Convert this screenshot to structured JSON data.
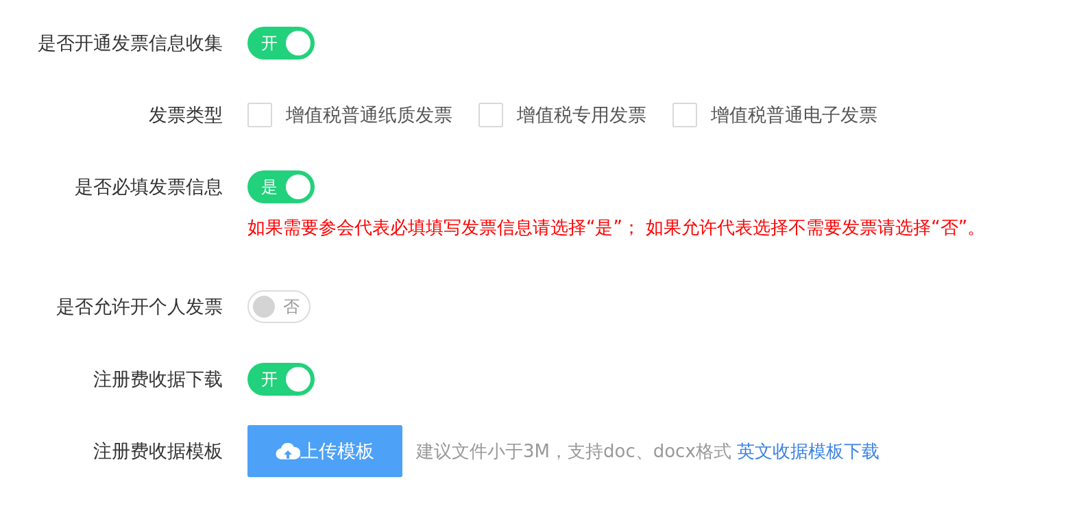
{
  "rows": [
    {
      "kind": "switch",
      "label": "是否开通发票信息收集",
      "on": true,
      "text": "开"
    },
    {
      "kind": "checkboxes",
      "label": "发票类型",
      "options": [
        {
          "label": "增值税普通纸质发票",
          "checked": false
        },
        {
          "label": "增值税专用发票",
          "checked": false
        },
        {
          "label": "增值税普通电子发票",
          "checked": false
        }
      ]
    },
    {
      "kind": "switch",
      "label": "是否必填发票信息",
      "on": true,
      "text": "是",
      "note": "如果需要参会代表必填填写发票信息请选择“是”； 如果允许代表选择不需要发票请选择“否”。"
    },
    {
      "kind": "switch",
      "label": "是否允许开个人发票",
      "on": false,
      "text": "否"
    },
    {
      "kind": "switch",
      "label": "注册费收据下载",
      "on": true,
      "text": "开"
    },
    {
      "kind": "upload",
      "label": "注册费收据模板",
      "button": "上传模板",
      "hint": "建议文件小于3M，支持doc、docx格式",
      "link": "英文收据模板下载"
    }
  ]
}
